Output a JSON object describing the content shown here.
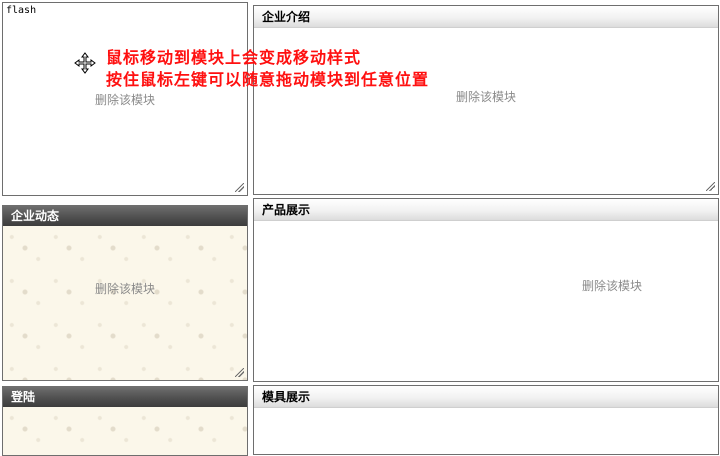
{
  "annotation": {
    "line1": "鼠标移动到模块上会变成移动样式",
    "line2": "按住鼠标左键可以随意拖动模块到任意位置"
  },
  "modules": {
    "flash": {
      "label": "flash",
      "delete_label": "删除该模块"
    },
    "company_intro": {
      "title": "企业介绍",
      "delete_label": "删除该模块"
    },
    "company_news": {
      "title": "企业动态",
      "delete_label": "删除该模块"
    },
    "products": {
      "title": "产品展示",
      "delete_label": "删除该模块"
    },
    "login": {
      "title": "登陆"
    },
    "molds": {
      "title": "模具展示"
    }
  },
  "colors": {
    "annotation": "#ff1010",
    "dark_header": "#505050",
    "pattern_bg": "#fbf7ea",
    "delete_text": "#8a8a8a"
  },
  "icons": {
    "cursor": "move-cursor-icon",
    "grip": "resize-grip-icon"
  }
}
